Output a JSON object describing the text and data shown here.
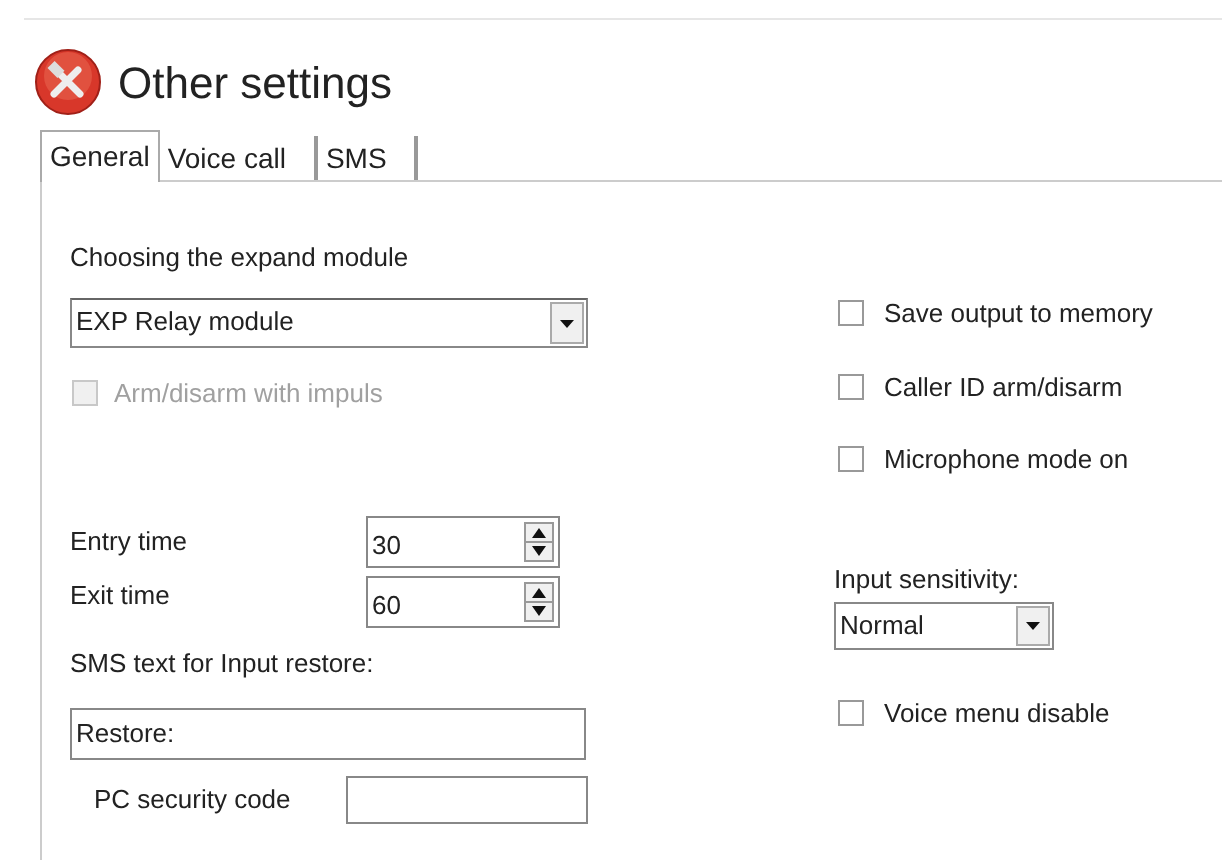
{
  "window": {
    "title": "Other settings"
  },
  "tabs": [
    {
      "label": "General",
      "selected": true
    },
    {
      "label": "Voice call",
      "selected": false
    },
    {
      "label": "SMS",
      "selected": false
    }
  ],
  "left": {
    "module_label": "Choosing the expand module",
    "module_value": "EXP Relay module",
    "impulse": {
      "label": "Arm/disarm with impuls",
      "checked": false,
      "disabled": true
    },
    "entry_time": {
      "label": "Entry time",
      "value": "30"
    },
    "exit_time": {
      "label": "Exit time",
      "value": "60"
    },
    "sms_label": "SMS text for Input restore:",
    "sms_value": "Restore:",
    "pc_code": {
      "label": "PC security code"
    }
  },
  "right": {
    "checkboxes": [
      {
        "label": "Save output to memory",
        "checked": false
      },
      {
        "label": "Caller ID arm/disarm",
        "checked": false
      },
      {
        "label": "Microphone mode on",
        "checked": false
      }
    ],
    "sensitivity_label": "Input sensitivity:",
    "sensitivity_value": "Normal",
    "voice_menu": {
      "label": "Voice menu disable",
      "checked": false
    }
  }
}
